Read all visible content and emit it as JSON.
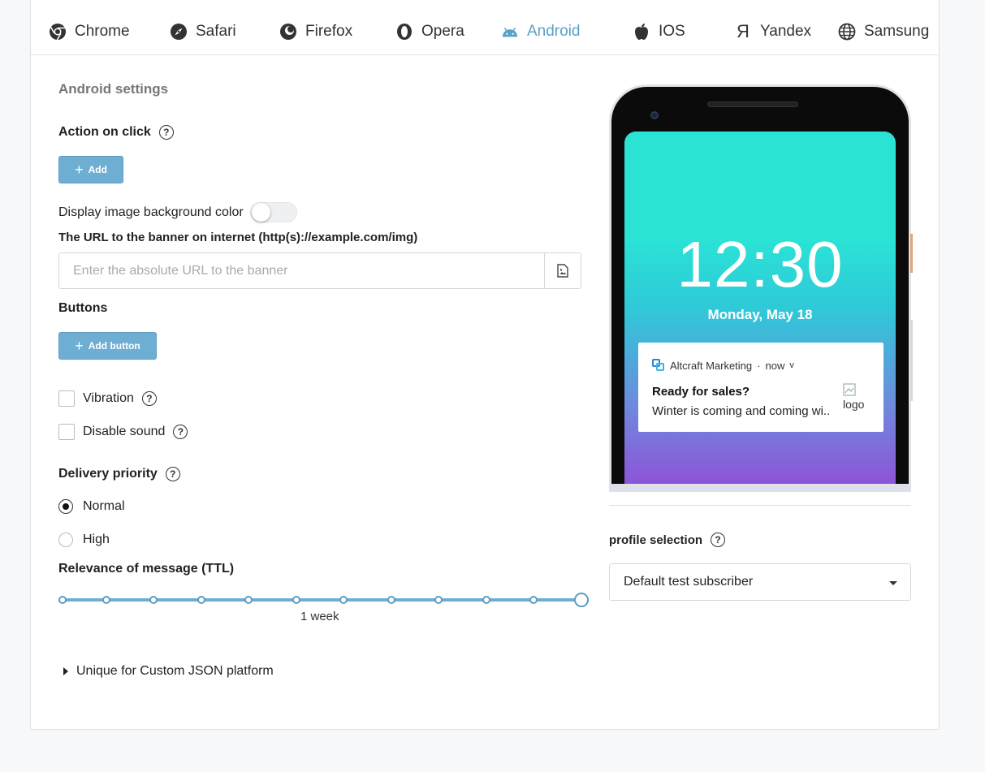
{
  "tabs": [
    {
      "label": "Chrome",
      "icon": "chrome-icon"
    },
    {
      "label": "Safari",
      "icon": "safari-icon"
    },
    {
      "label": "Firefox",
      "icon": "firefox-icon"
    },
    {
      "label": "Opera",
      "icon": "opera-icon"
    },
    {
      "label": "Android",
      "icon": "android-icon",
      "active": true
    },
    {
      "label": "IOS",
      "icon": "apple-icon"
    },
    {
      "label": "Yandex",
      "icon": "yandex-icon"
    },
    {
      "label": "Samsung",
      "icon": "globe-icon"
    }
  ],
  "settings": {
    "title": "Android settings",
    "action_on_click": "Action on click",
    "add_label": "Add",
    "display_bg_color": "Display image background color",
    "url_label": "The URL to the banner on internet (http(s)://example.com/img)",
    "url_placeholder": "Enter the absolute URL to the banner",
    "url_value": "",
    "buttons_label": "Buttons",
    "add_button_label": "Add button",
    "vibration": "Vibration",
    "disable_sound": "Disable sound",
    "delivery_priority": "Delivery priority",
    "priority_options": [
      "Normal",
      "High"
    ],
    "priority_selected": "Normal",
    "ttl_label": "Relevance of message (TTL)",
    "ttl_value": "1 week",
    "custom_json": "Unique for Custom JSON platform"
  },
  "preview": {
    "time": "12:30",
    "date": "Monday, May 18",
    "app_name": "Altcraft Marketing",
    "when": "now",
    "chevron": "v",
    "notif_title": "Ready for sales?",
    "notif_text": "Winter is coming and coming wi..",
    "img_alt": "logo"
  },
  "profile": {
    "label": "profile selection",
    "selected": "Default test subscriber"
  },
  "colors": {
    "accent": "#5aa1c8",
    "button": "#6eaed3"
  }
}
